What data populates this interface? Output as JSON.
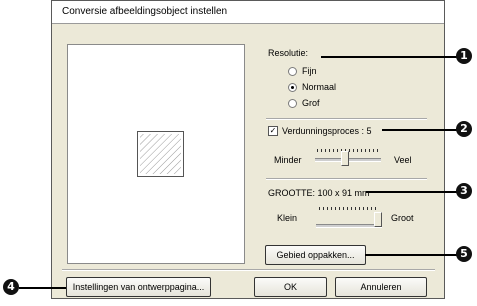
{
  "dialog": {
    "title": "Conversie afbeeldingsobject instellen"
  },
  "resolution": {
    "label": "Resolutie:",
    "options": [
      "Fijn",
      "Normaal",
      "Grof"
    ],
    "selected": "Normaal"
  },
  "thinning": {
    "checkbox_label": "Verdunningsproces : 5",
    "checked": true,
    "min_label": "Minder",
    "max_label": "Veel",
    "value": 5
  },
  "size": {
    "label": "GROOTTE:  100 x 91 mm",
    "min_label": "Klein",
    "max_label": "Groot",
    "level": 1.0
  },
  "buttons": {
    "pick_area": "Gebied oppakken...",
    "design_page_settings": "Instellingen van ontwerppagina...",
    "ok": "OK",
    "cancel": "Annuleren"
  },
  "callouts": [
    "1",
    "2",
    "3",
    "4",
    "5"
  ]
}
